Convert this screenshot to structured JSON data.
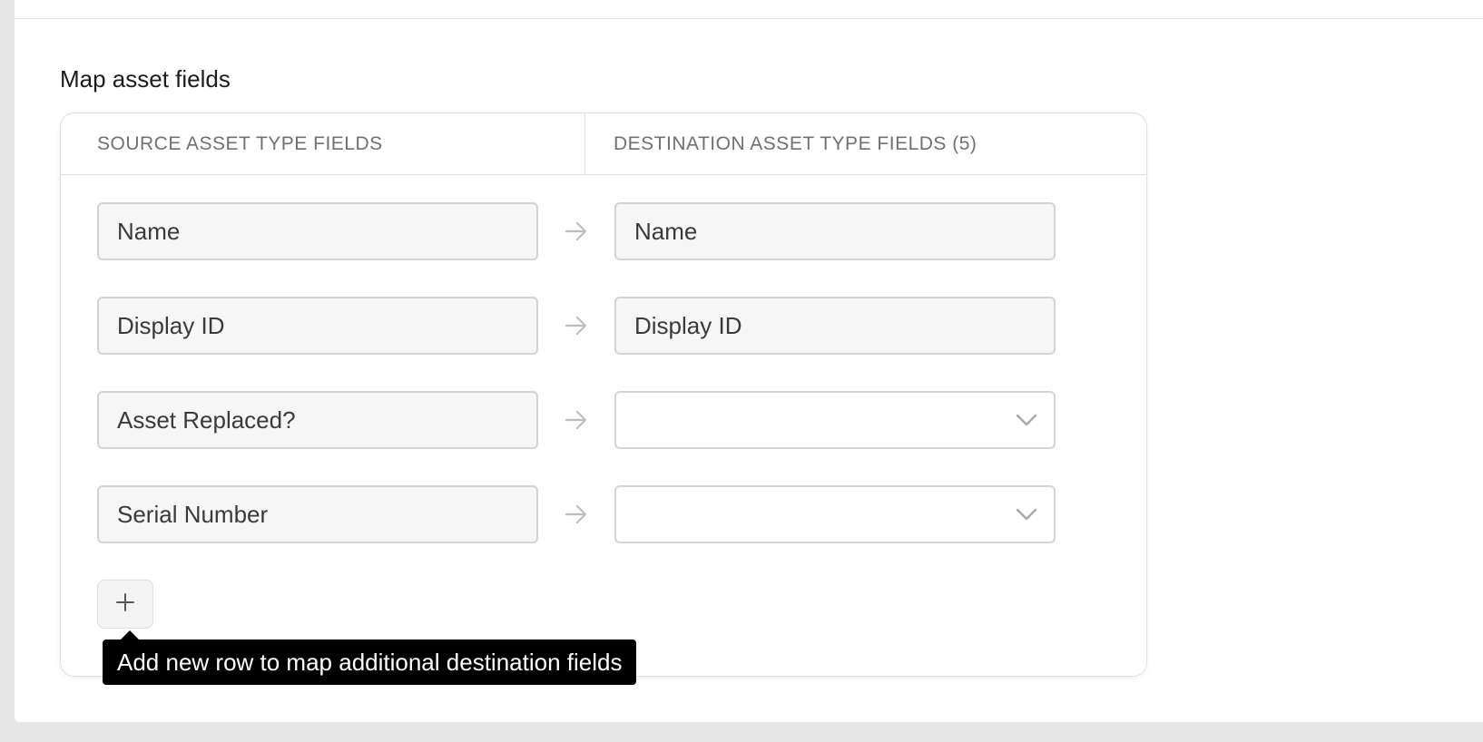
{
  "section": {
    "title": "Map asset fields"
  },
  "columns": {
    "source_header": "SOURCE ASSET TYPE FIELDS",
    "destination_header": "DESTINATION ASSET TYPE FIELDS (5)"
  },
  "rows": [
    {
      "source": "Name",
      "destination": "Name",
      "destination_type": "static"
    },
    {
      "source": "Display ID",
      "destination": "Display ID",
      "destination_type": "static"
    },
    {
      "source": "Asset Replaced?",
      "destination": "",
      "destination_type": "select"
    },
    {
      "source": "Serial Number",
      "destination": "",
      "destination_type": "select"
    }
  ],
  "add_row": {
    "icon": "plus-icon",
    "tooltip": "Add new row to map additional destination fields"
  },
  "icons": {
    "arrow": "arrow-right-icon",
    "dropdown": "chevron-down-icon"
  },
  "colors": {
    "tooltip_bg": "#000000",
    "field_bg": "#f6f6f6",
    "border": "#d4d4d4"
  }
}
